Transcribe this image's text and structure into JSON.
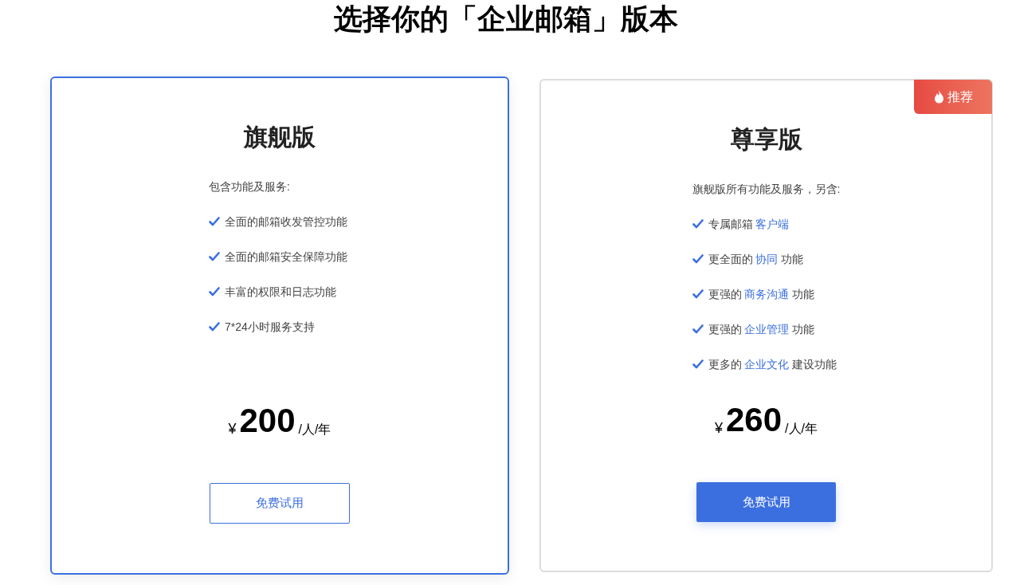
{
  "title": "选择你的「企业邮箱」版本",
  "plans": [
    {
      "name": "旗舰版",
      "selected": true,
      "intro": "包含功能及服务:",
      "features": [
        {
          "before": "全面的邮箱收发管控功能"
        },
        {
          "before": "全面的邮箱安全保障功能"
        },
        {
          "before": "丰富的权限和日志功能"
        },
        {
          "before": "7*24小时服务支持"
        }
      ],
      "currency": "¥",
      "price": "200",
      "unit": "/人/年",
      "button": "免费试用"
    },
    {
      "name": "尊享版",
      "selected": false,
      "badge": "推荐",
      "intro": "旗舰版所有功能及服务，另含:",
      "features": [
        {
          "before": "专属邮箱 ",
          "highlight": "客户端"
        },
        {
          "before": "更全面的 ",
          "highlight": "协同",
          "after": " 功能"
        },
        {
          "before": "更强的 ",
          "highlight": "商务沟通",
          "after": " 功能"
        },
        {
          "before": "更强的 ",
          "highlight": "企业管理",
          "after": " 功能"
        },
        {
          "before": "更多的 ",
          "highlight": "企业文化",
          "after": " 建设功能"
        }
      ],
      "currency": "¥",
      "price": "260",
      "unit": "/人/年",
      "button": "免费试用"
    }
  ]
}
